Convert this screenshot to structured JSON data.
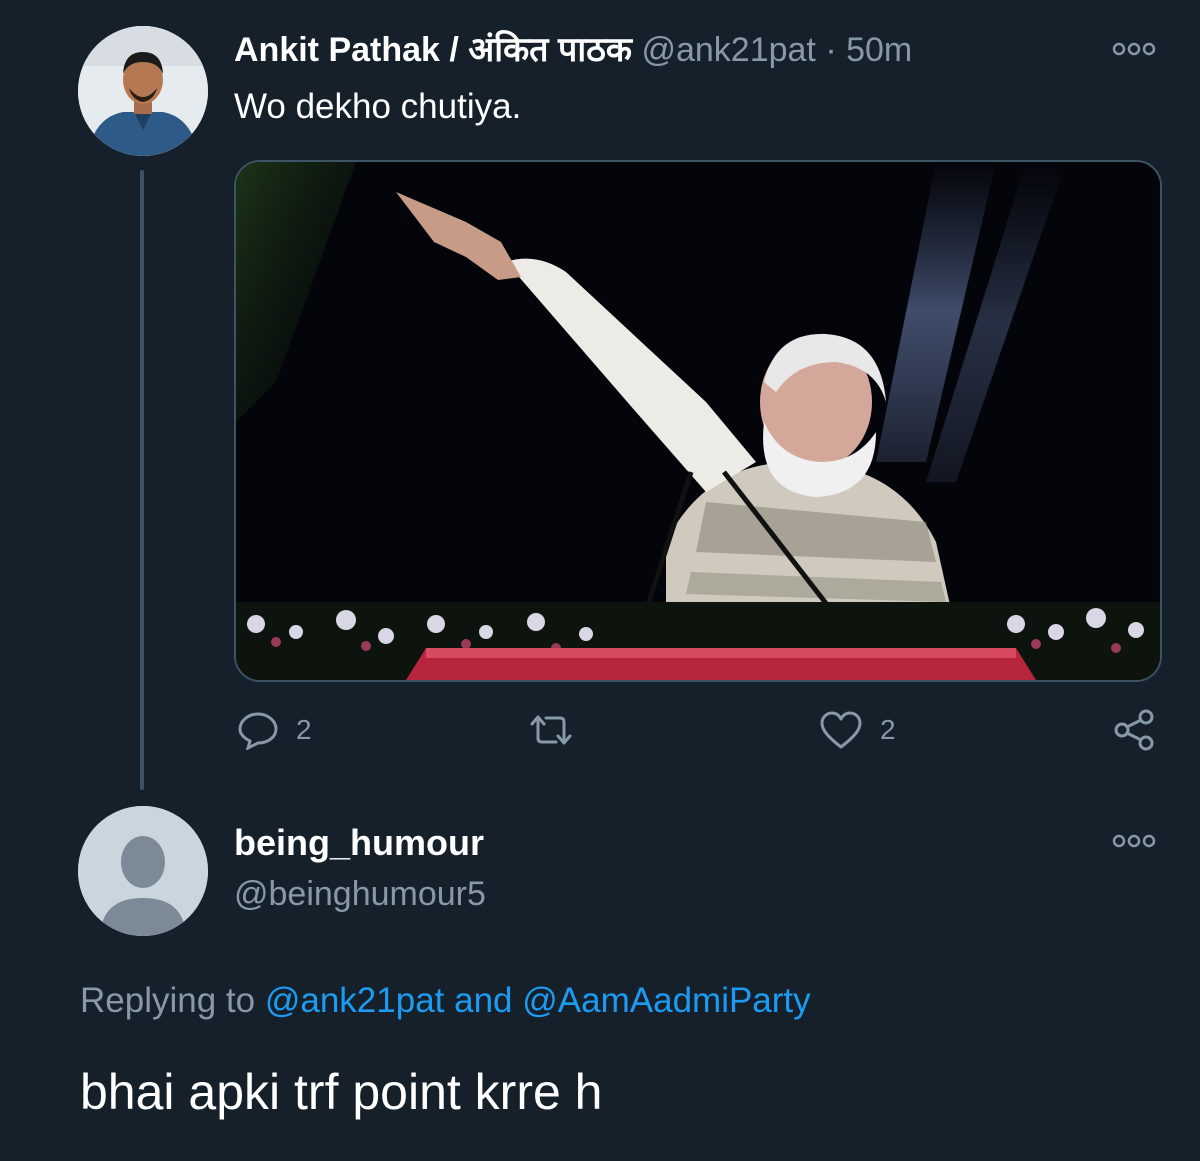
{
  "tweet": {
    "display_name": "Ankit Pathak / अंकित पाठक",
    "handle": "@ank21pat",
    "separator": "·",
    "time": "50m",
    "text": "Wo dekho chutiya.",
    "more_icon": "more-dots-icon",
    "actions": {
      "reply": {
        "icon": "reply-bubble-icon",
        "count": "2"
      },
      "retweet": {
        "icon": "retweet-icon",
        "count": ""
      },
      "like": {
        "icon": "heart-icon",
        "count": "2"
      },
      "share": {
        "icon": "share-icon"
      }
    }
  },
  "reply": {
    "display_name": "being_humour",
    "handle": "@beinghumour5",
    "replying_label": "Replying to",
    "mention_1": "@ank21pat",
    "conjunction": "and",
    "mention_2": "@AamAadmiParty",
    "text": "bhai apki trf point krre h",
    "more_icon": "more-dots-icon"
  },
  "colors": {
    "background": "#15202b",
    "secondary_text": "#8899a6",
    "link": "#1d9bf0",
    "border": "#3d5466"
  }
}
